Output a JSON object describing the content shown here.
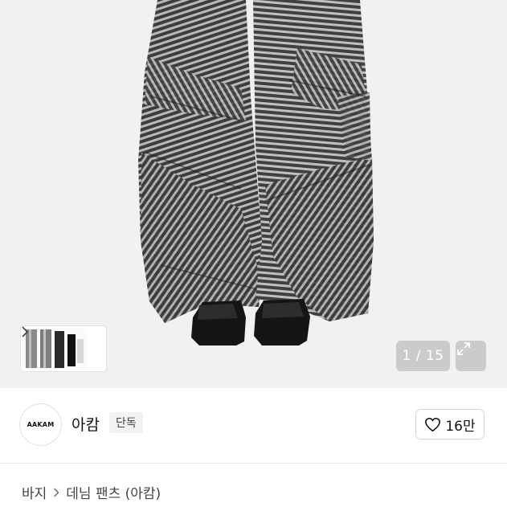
{
  "gallery": {
    "image_alt": "striped wide-leg pants",
    "page_counter": "1 / 15",
    "thumbnail_arrow_icon": "chevron-right-icon",
    "expand_icon": "expand-diagonal-icon"
  },
  "brand": {
    "logo_text": "AAKAM",
    "name": "아캄",
    "badge": "단독",
    "like_count": "16만",
    "like_icon": "heart-outline-icon"
  },
  "breadcrumb": {
    "category": "바지",
    "separator_icon": "chevron-right-icon",
    "product_title": "데님 팬츠 (아캄)"
  },
  "colors": {
    "hero_background": "#f1f1f1",
    "counter_background": "#c8c8c8",
    "badge_background": "#f2f2f2"
  }
}
